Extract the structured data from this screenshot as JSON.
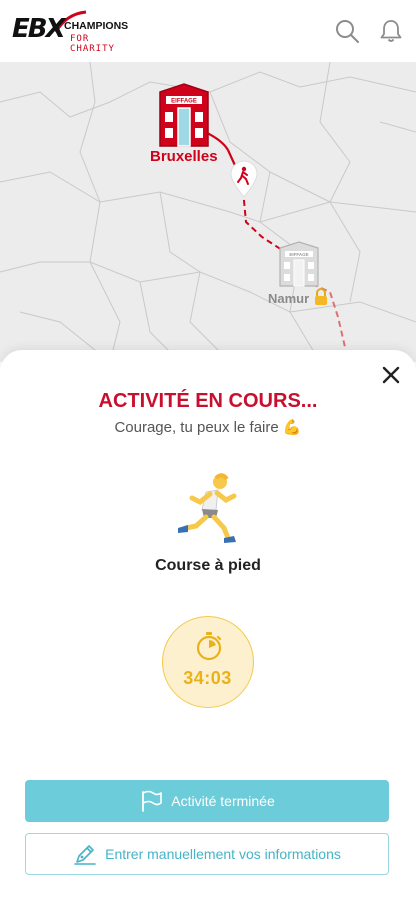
{
  "header": {
    "logo_main": "EBX",
    "logo_champions": "CHAMPIONS",
    "logo_charity": "FOR CHARITY",
    "icons": [
      "search-icon",
      "bell-icon"
    ]
  },
  "map": {
    "city_start": "Bruxelles",
    "city_next": "Namur",
    "building_sign": "EIFFAGE",
    "colors": {
      "route": "#d0021b",
      "start_building": "#d0021b",
      "locked_building": "#bdbdbd"
    }
  },
  "sheet": {
    "title": "ACTIVITÉ EN COURS...",
    "subtitle": "Courage, tu peux le faire 💪",
    "activity_name": "Course à pied",
    "timer": "34:03",
    "primary_button": "Activité terminée",
    "secondary_button": "Entrer manuellement vos informations",
    "colors": {
      "accent": "#c8102e",
      "primary_button": "#6dccd9",
      "timer": "#e9b21a"
    }
  }
}
